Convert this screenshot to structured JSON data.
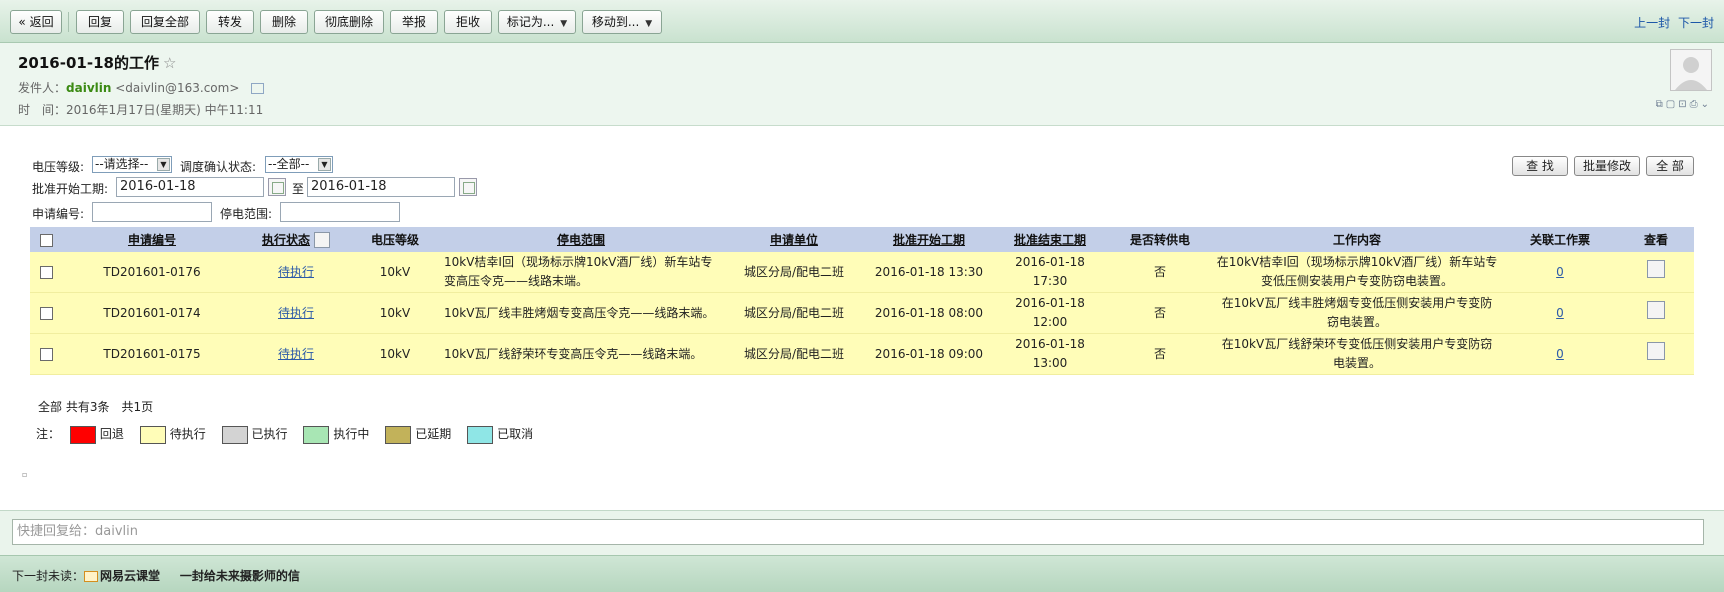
{
  "toolbar": {
    "back": "« 返回",
    "reply": "回复",
    "reply_all": "回复全部",
    "forward": "转发",
    "delete": "删除",
    "delete_permanent": "彻底删除",
    "report": "举报",
    "reject": "拒收",
    "mark_as": "标记为...",
    "move_to": "移动到...",
    "prev_mail": "上一封",
    "next_mail": "下一封"
  },
  "mail": {
    "subject": "2016-01-18的工作",
    "star": "☆",
    "sender_label": "发件人：",
    "sender_name": "daivlin",
    "sender_email": "<daivlin@163.com>",
    "time_label": "时　间：",
    "time_value": "2016年1月17日(星期天) 中午11:11"
  },
  "filters": {
    "voltage_label": "电压等级:",
    "voltage_value": "--请选择--",
    "dispatch_label": "调度确认状态:",
    "dispatch_value": "--全部--",
    "start_label": "批准开始工期:",
    "start_from": "2016-01-18",
    "to_label": "至",
    "start_to": "2016-01-18",
    "apply_no_label": "申请编号:",
    "outage_label": "停电范围:",
    "search_btn": "查 找",
    "batch_btn": "批量修改",
    "all_btn": "全 部"
  },
  "table": {
    "headers": {
      "apply_no": "申请编号",
      "status": "执行状态",
      "voltage": "电压等级",
      "range": "停电范围",
      "unit": "申请单位",
      "start": "批准开始工期",
      "end": "批准结束工期",
      "transfer": "是否转供电",
      "content": "工作内容",
      "tickets": "关联工作票",
      "view": "查看"
    },
    "rows": [
      {
        "apply_no": "TD201601-0176",
        "status": "待执行",
        "voltage": "10kV",
        "range": "10kV桔幸I回（现场标示牌10kV酒厂线）新车站专变高压令克——线路末端。",
        "unit": "城区分局/配电二班",
        "start": "2016-01-18 13:30",
        "end": "2016-01-18 17:30",
        "transfer": "否",
        "content": "在10kV桔幸I回（现场标示牌10kV酒厂线）新车站专变低压侧安装用户专变防窃电装置。",
        "tickets": "0"
      },
      {
        "apply_no": "TD201601-0174",
        "status": "待执行",
        "voltage": "10kV",
        "range": "10kV瓦厂线丰胜烤烟专变高压令克——线路末端。",
        "unit": "城区分局/配电二班",
        "start": "2016-01-18 08:00",
        "end": "2016-01-18 12:00",
        "transfer": "否",
        "content": "在10kV瓦厂线丰胜烤烟专变低压侧安装用户专变防窃电装置。",
        "tickets": "0"
      },
      {
        "apply_no": "TD201601-0175",
        "status": "待执行",
        "voltage": "10kV",
        "range": "10kV瓦厂线舒荣环专变高压令克——线路末端。",
        "unit": "城区分局/配电二班",
        "start": "2016-01-18 09:00",
        "end": "2016-01-18 13:00",
        "transfer": "否",
        "content": "在10kV瓦厂线舒荣环专变低压侧安装用户专变防窃电装置。",
        "tickets": "0"
      }
    ]
  },
  "summary": "全部 共有3条　共1页",
  "legend": {
    "note": "注：",
    "items": [
      {
        "label": "回退",
        "color": "#ff0000"
      },
      {
        "label": "待执行",
        "color": "#fffdb8"
      },
      {
        "label": "已执行",
        "color": "#d3d3d3"
      },
      {
        "label": "执行中",
        "color": "#a8e6b4"
      },
      {
        "label": "已延期",
        "color": "#c2b25a"
      },
      {
        "label": "已取消",
        "color": "#8fe6e6"
      }
    ]
  },
  "reply": {
    "placeholder": "快捷回复给：daivlin"
  },
  "next_unread": {
    "label": "下一封未读：",
    "sender": "网易云课堂",
    "subject": "一封给未来摄影师的信"
  }
}
